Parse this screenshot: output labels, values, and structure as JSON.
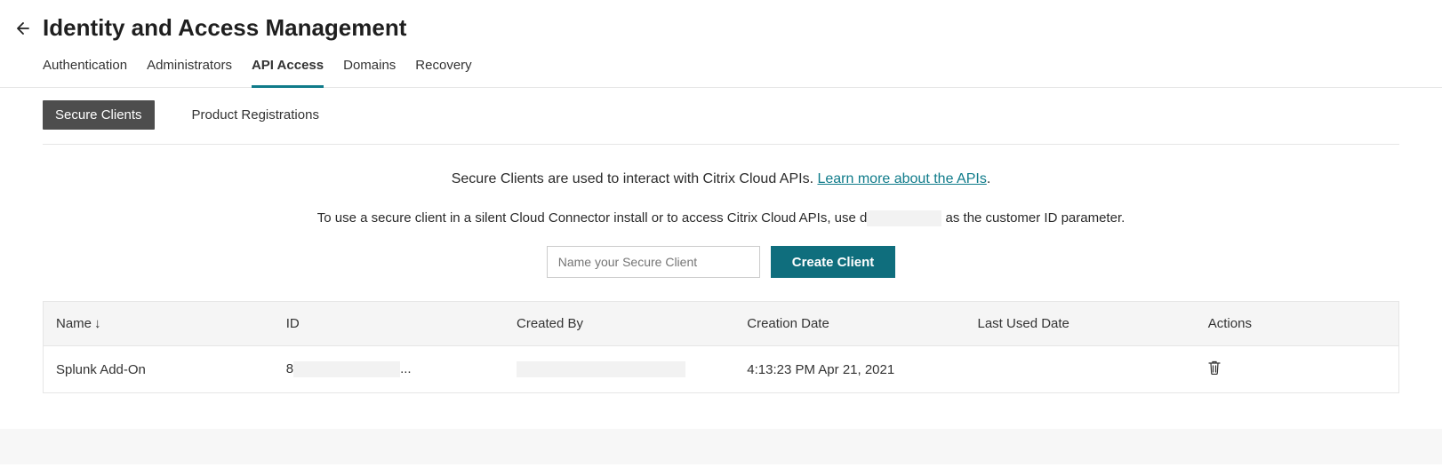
{
  "header": {
    "title": "Identity and Access Management"
  },
  "tabs": [
    {
      "label": "Authentication"
    },
    {
      "label": "Administrators"
    },
    {
      "label": "API Access",
      "active": true
    },
    {
      "label": "Domains"
    },
    {
      "label": "Recovery"
    }
  ],
  "subtabs": [
    {
      "label": "Secure Clients",
      "active": true
    },
    {
      "label": "Product Registrations"
    }
  ],
  "info": {
    "line1_text": "Secure Clients are used to interact with Citrix Cloud APIs. ",
    "line1_link": "Learn more about the APIs",
    "line1_period": ".",
    "line2_prefix": "To use a secure client in a silent Cloud Connector install or to access Citrix Cloud APIs, use d",
    "line2_suffix": " as the customer ID parameter."
  },
  "form": {
    "placeholder": "Name your Secure Client",
    "create_label": "Create Client"
  },
  "table": {
    "columns": {
      "name": "Name",
      "id": "ID",
      "created_by": "Created By",
      "creation_date": "Creation Date",
      "last_used": "Last Used Date",
      "actions": "Actions"
    },
    "rows": [
      {
        "name": "Splunk Add-On",
        "id_prefix": "8",
        "id_suffix": "...",
        "created_by": "",
        "creation_date": "4:13:23 PM Apr 21, 2021",
        "last_used": ""
      }
    ]
  }
}
